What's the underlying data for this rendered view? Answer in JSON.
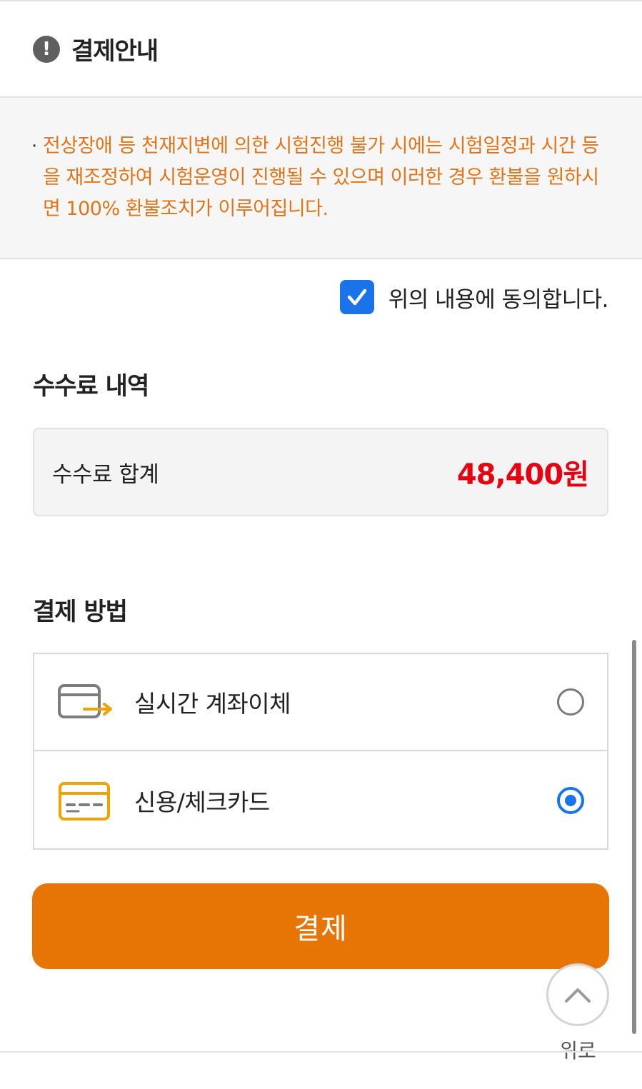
{
  "notice": {
    "title": "결제안내",
    "icon": "exclamation-icon",
    "text": "전상장애 등 천재지변에 의한 시험진행 불가 시에는 시험일정과 시간 등을 재조정하여 시험운영이 진행될 수 있으며 이러한 경우 환불을 원하시면 100% 환불조치가 이루어집니다.",
    "text_color": "#e0741a"
  },
  "agreement": {
    "label": "위의 내용에 동의합니다.",
    "checked": true
  },
  "fee": {
    "section_title": "수수료 내역",
    "label": "수수료 합계",
    "amount": "48,400원",
    "amount_color": "#e50012"
  },
  "payment": {
    "section_title": "결제 방법",
    "methods": [
      {
        "label": "실시간 계좌이체",
        "icon": "bank-transfer-icon",
        "selected": false
      },
      {
        "label": "신용/체크카드",
        "icon": "credit-card-icon",
        "selected": true
      }
    ],
    "pay_label": "결제",
    "accent": "#e67505"
  },
  "scroll_top": {
    "label": "위로"
  }
}
